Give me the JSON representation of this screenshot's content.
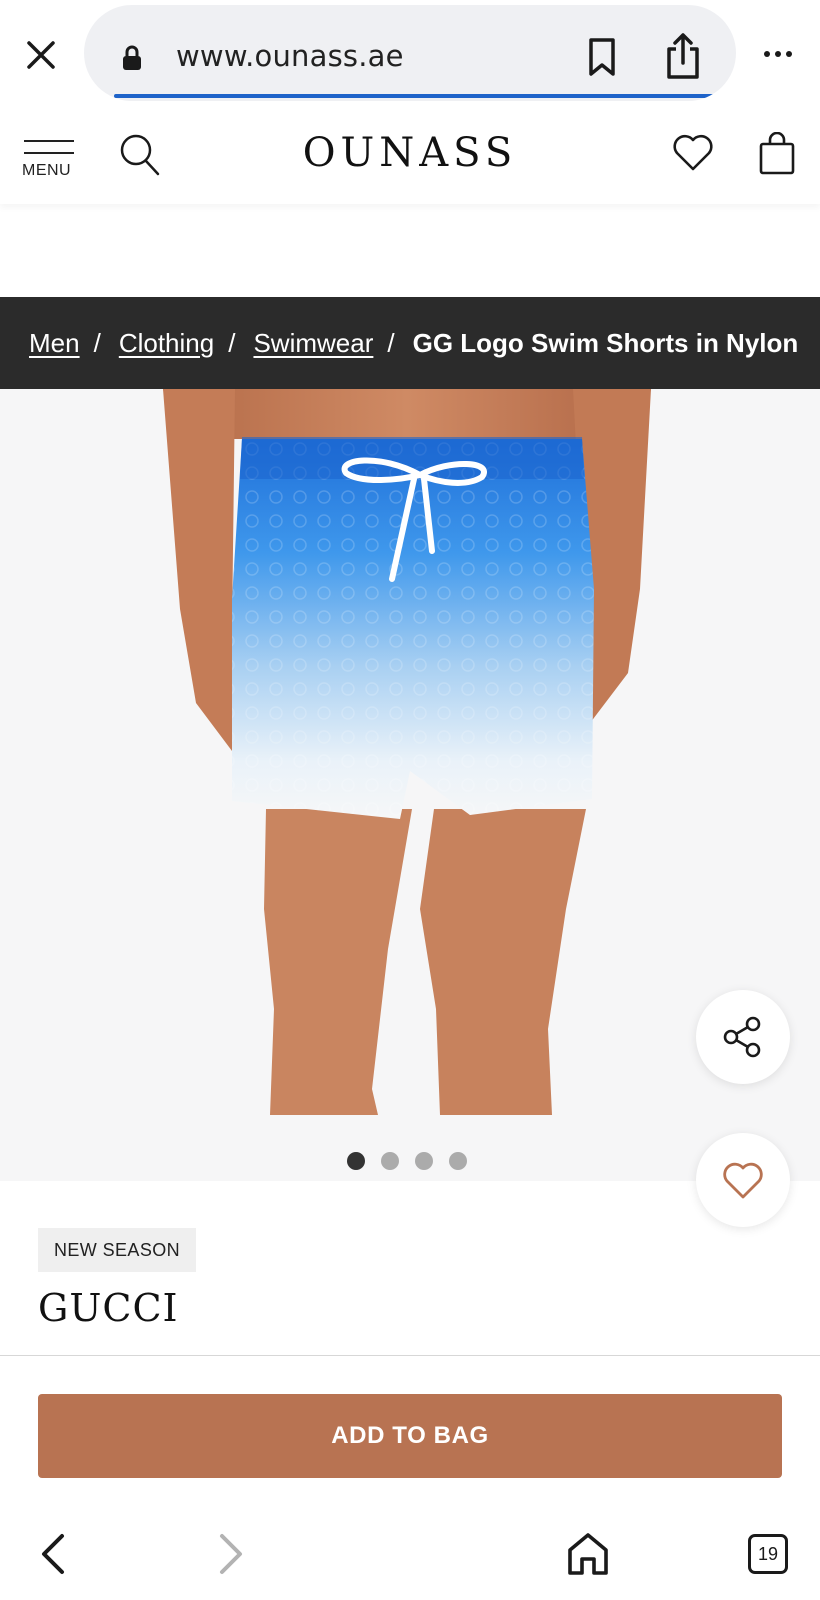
{
  "browser": {
    "url": "www.ounass.ae",
    "tab_count": "19",
    "icons": {
      "close": "close-icon",
      "lock": "lock-icon",
      "bookmark": "bookmark-icon",
      "share": "share-icon",
      "more": "more-icon",
      "back": "back-icon",
      "forward": "forward-icon",
      "home": "home-icon",
      "tabs": "tabs-icon"
    },
    "load_progress": 0.92
  },
  "header": {
    "menu_label": "MENU",
    "logo": "OUNASS",
    "icons": {
      "menu": "hamburger-icon",
      "search": "search-icon",
      "wishlist": "heart-icon",
      "bag": "shopping-bag-icon"
    }
  },
  "breadcrumb": {
    "items": [
      "Men",
      "Clothing",
      "Swimwear"
    ],
    "separator": "/",
    "current": "GG Logo Swim Shorts in Nylon"
  },
  "gallery": {
    "image_count": 4,
    "active_index": 0,
    "actions": {
      "share": "share-icon",
      "wishlist": "heart-icon"
    }
  },
  "product": {
    "badge": "NEW SEASON",
    "brand": "GUCCI"
  },
  "cta": {
    "add_to_bag": "ADD TO BAG"
  },
  "colors": {
    "breadcrumb_bg": "#2b2b2b",
    "cta_bg": "#b87352",
    "heart_accent": "#b87352",
    "url_progress": "#1e63c9"
  }
}
